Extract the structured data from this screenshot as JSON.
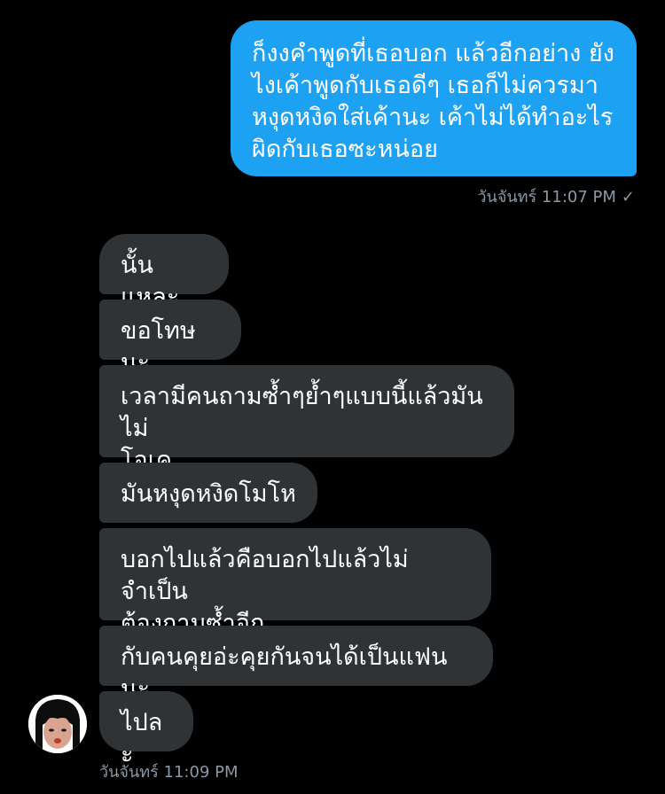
{
  "conversation": {
    "outgoing": {
      "text": "ก็งงคำพูดที่เธอบอก แล้วอีกอย่าง ยัง\nไงเค้าพูดกับเธอดีๆ เธอก็ไม่ควรมา\nหงุดหงิดใส่เค้านะ เค้าไม่ได้ทำอะไร\nผิดกับเธอซะหน่อย",
      "timestamp": "วันจันทร์ 11:07 PM",
      "read_icon": "checkmark-icon",
      "read_symbol": "✓",
      "color": "#1da1f2"
    },
    "incoming": {
      "messages": [
        "นั้นแหละ",
        "ขอโทษนะ",
        "เวลามีคนถามซ้ำๆย้ำๆแบบนี้แล้วมันไม่\nโอเค",
        "มันหงุดหงิดโมโห",
        "บอกไปแล้วคือบอกไปแล้วไม่จำเป็น\nต้องถามซ้ำอีก",
        "กับคนคุยอ่ะคุยกันจนได้เป็นแฟนนะ",
        "ไปละ"
      ],
      "timestamp": "วันจันทร์ 11:09 PM",
      "avatar_icon": "avatar-icon",
      "color": "#2f3336"
    }
  }
}
